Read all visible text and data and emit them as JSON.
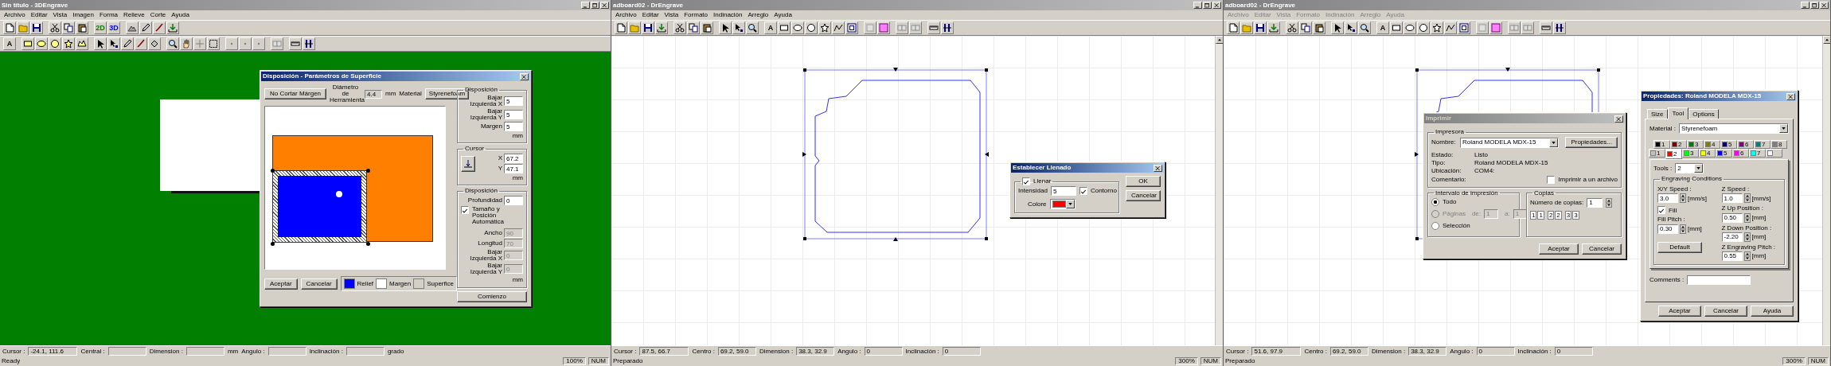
{
  "windows": [
    {
      "kind": "relief",
      "title": "Sin título - 3DEngrave",
      "menu_dimmed": false,
      "menu": [
        "Archivo",
        "Editar",
        "Vista",
        "Imagen",
        "Forma",
        "Relieve",
        "Corte",
        "Ayuda"
      ],
      "tool_labels": [
        {
          "label": "2D",
          "color": "#008000"
        },
        {
          "label": "3D",
          "color": "#0000ff"
        },
        {
          "label": "A",
          "color": "#000000"
        }
      ],
      "status": [
        {
          "label": "Cursor :",
          "value": "-24.1, 111.6"
        },
        {
          "label": "Central :"
        },
        {
          "label": "Dimension :",
          "unit": "mm"
        },
        {
          "label": "Angulo :"
        },
        {
          "label": "Inclinación :",
          "unit": "grado"
        }
      ],
      "app_status": [
        "Ready",
        "100%",
        "NUM"
      ],
      "surface_dialog": {
        "title": "Disposición - Parámetros de Superficie",
        "active": true,
        "no_cut": "No Cortar Márgen",
        "tool_label": "Diámetro de Herramienta",
        "tool_value": "4.4",
        "tool_unit": "mm",
        "material_label": "Material",
        "material": "Styrenefoam",
        "groups": [
          {
            "kind": "fields",
            "legend": "Disposición",
            "fields": [
              {
                "label": "Bajar Izquierda X",
                "value": "5",
                "disabled": false
              },
              {
                "label": "Bajar Izquierda Y",
                "value": "5",
                "disabled": false
              },
              {
                "label": "Margen",
                "value": "5",
                "disabled": false
              }
            ],
            "unit": "mm"
          },
          {
            "kind": "cursor",
            "legend": "Cursor",
            "fields": [
              {
                "label": "X",
                "value": "67.2",
                "disabled": false
              },
              {
                "label": "Y",
                "value": "47.1",
                "disabled": false
              }
            ],
            "unit": "mm"
          },
          {
            "kind": "auto",
            "legend": "Disposición",
            "fields": [
              {
                "label": "Profundidad",
                "value": "0",
                "disabled": false
              }
            ],
            "auto": {
              "label": "Tamaño y Posición Automática",
              "checked": true
            },
            "more_fields": [
              {
                "label": "Ancho",
                "value": "90",
                "disabled": true
              },
              {
                "label": "Longitud",
                "value": "70",
                "disabled": true
              },
              {
                "label": "Bajar Izquierda X",
                "value": "0",
                "disabled": true
              },
              {
                "label": "Bajar Izquierda Y",
                "value": "0",
                "disabled": true
              }
            ],
            "unit": "mm"
          }
        ],
        "buttons": [
          "Aceptar",
          "Cancelar"
        ],
        "legend": [
          {
            "label": "Relief",
            "color": "#0000ff"
          },
          {
            "label": "Margen",
            "color": "#ffffff"
          },
          {
            "label": "Superfice",
            "color": "#d4d0c8"
          }
        ],
        "start_button": "Comienzo"
      }
    },
    {
      "kind": "drawing",
      "title": "adboard02 - DrEngrave",
      "menu_dimmed": false,
      "menu": [
        "Archivo",
        "Editar",
        "Vista",
        "Formato",
        "Indinación",
        "Arreglo",
        "Ayuda"
      ],
      "tool_labels": [
        {
          "label": "A",
          "color": "#000000"
        }
      ],
      "status": [
        {
          "label": "Cursor :",
          "value": "87.5, 66.7"
        },
        {
          "label": "Centro :",
          "value": "69.2, 59.0"
        },
        {
          "label": "Dimension :",
          "value": "38.3, 32.9"
        },
        {
          "label": "Angulo :",
          "value": "0"
        },
        {
          "label": "Inclinación :",
          "value": "0"
        }
      ],
      "app_status": [
        "Preparado",
        "300%",
        "NUM"
      ],
      "fill_dialog": {
        "title": "Establecer Llenado",
        "active": true,
        "fill": {
          "label": "Llenar",
          "checked": true
        },
        "intensity_label": "Intensidad",
        "intensity": "5",
        "outline": {
          "label": "Contorno",
          "checked": true
        },
        "color_label": "Colore",
        "color": "#ff0000",
        "buttons": [
          "OK",
          "Cancelar"
        ]
      }
    },
    {
      "kind": "drawing",
      "title": "adboard02 - DrEngrave",
      "menu_dimmed": true,
      "menu": [
        "Archivo",
        "Editar",
        "Vista",
        "Formato",
        "Indinación",
        "Arreglo",
        "Ayuda"
      ],
      "tool_labels": [
        {
          "label": "A",
          "color": "#000000"
        }
      ],
      "status": [
        {
          "label": "Cursor :",
          "value": "51.6, 97.9"
        },
        {
          "label": "Centro :",
          "value": "69.2, 59.0"
        },
        {
          "label": "Dimension :",
          "value": "38.3, 32.9"
        },
        {
          "label": "Angulo :",
          "value": "0"
        },
        {
          "label": "Inclinación :",
          "value": "0"
        }
      ],
      "app_status": [
        "Preparado",
        "300%",
        "NUM"
      ],
      "print_dialog": {
        "title": "Imprimir",
        "active": false,
        "printer_legend": "Impresora",
        "name_label": "Nombre:",
        "printer": "Roland MODELA MDX-15",
        "properties_button": "Propiedades...",
        "info": [
          {
            "label": "Estado:",
            "value": "Listo"
          },
          {
            "label": "Tipo:",
            "value": "Roland MODELA MDX-15"
          },
          {
            "label": "Ubicación:",
            "value": "COM4:"
          },
          {
            "label": "Comentario:"
          }
        ],
        "to_file": {
          "label": "Imprimir a un archivo",
          "checked": false
        },
        "range_legend": "Intervalo de impresión",
        "range": [
          {
            "label": "Todo",
            "selected": true,
            "disabled": false
          },
          {
            "label": "Páginas",
            "selected": false,
            "disabled": true
          },
          {
            "label": "Selección",
            "selected": false,
            "disabled": false
          }
        ],
        "from_label": "de:",
        "from": "1",
        "to_label": "a:",
        "to": "1",
        "copies_legend": "Copias",
        "copies_label": "Número de copias:",
        "copies": "1",
        "collate_labels": [
          "1",
          "1",
          "2",
          "2",
          "3",
          "3"
        ],
        "buttons": [
          "Aceptar",
          "Cancelar"
        ]
      },
      "properties_dialog": {
        "title": "Propiedades: Roland MODELA MDX-15",
        "active": true,
        "tabs": [
          {
            "label": "Size",
            "selected": false
          },
          {
            "label": "Tool",
            "selected": true
          },
          {
            "label": "Options",
            "selected": false
          }
        ],
        "material_label": "Material :",
        "material": "Styrenefoam",
        "pen_rows": [
          [
            {
              "label": "1",
              "color": "#000000",
              "selected": false
            },
            {
              "label": "2",
              "color": "#800000",
              "selected": false
            },
            {
              "label": "3",
              "color": "#008000",
              "selected": false
            },
            {
              "label": "4",
              "color": "#808000",
              "selected": false
            },
            {
              "label": "5",
              "color": "#000080",
              "selected": false
            },
            {
              "label": "6",
              "color": "#800080",
              "selected": false
            },
            {
              "label": "7",
              "color": "#008080",
              "selected": false
            },
            {
              "label": "8",
              "color": "#808080",
              "selected": false
            }
          ],
          [
            {
              "label": "1",
              "color": "#c0c0c0",
              "selected": false
            },
            {
              "label": "2",
              "color": "#ff0000",
              "selected": true
            },
            {
              "label": "3",
              "color": "#00ff00",
              "selected": false
            },
            {
              "label": "4",
              "color": "#ffff00",
              "selected": false
            },
            {
              "label": "5",
              "color": "#0000ff",
              "selected": false
            },
            {
              "label": "6",
              "color": "#ff00ff",
              "selected": false
            },
            {
              "label": "7",
              "color": "#00ffff",
              "selected": false
            },
            {
              "color": "#ffffff",
              "selected": false
            }
          ]
        ],
        "tools_label": "Tools :",
        "tools": "2",
        "conditions_legend": "Engraving Conditions",
        "left": [
          {
            "kind": "value",
            "label": "X/Y Speed :",
            "value": "3.0",
            "unit": "[mm/s]"
          },
          {
            "kind": "check",
            "label": "Fill",
            "checked": true
          },
          {
            "kind": "value",
            "label": "Fill Pitch :",
            "value": "0.30",
            "unit": "[mm]"
          },
          {
            "kind": "button",
            "label": "Default"
          }
        ],
        "right": [
          {
            "kind": "value",
            "label": "Z Speed :",
            "value": "1.0",
            "unit": "[mm/s]"
          },
          {
            "kind": "value",
            "label": "Z Up Position :",
            "value": "0.50",
            "unit": "[mm]"
          },
          {
            "kind": "value",
            "label": "Z Down Position :",
            "value": "-2.20",
            "unit": "[mm]"
          },
          {
            "kind": "value",
            "label": "Z Engraving Pitch :",
            "value": "0.55",
            "unit": "[mm]"
          }
        ],
        "comments_label": "Comments :",
        "buttons": [
          "Aceptar",
          "Cancelar",
          "Ayuda"
        ]
      }
    }
  ]
}
